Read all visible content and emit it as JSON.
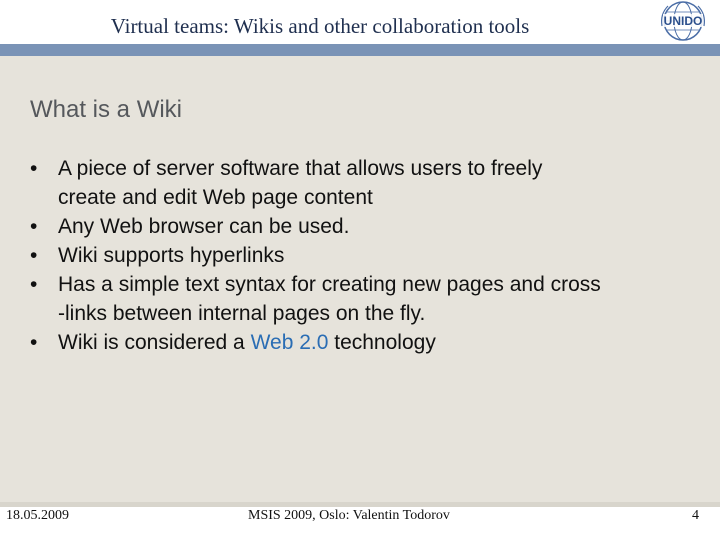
{
  "header": {
    "title": "Virtual teams: Wikis and other collaboration tools",
    "logo_text": "UNIDO"
  },
  "slide": {
    "title": "What is a Wiki",
    "bullets": [
      {
        "text_before": "A piece of server software that allows users to freely",
        "text_cont": "create and edit Web page content"
      },
      {
        "text_before": "Any Web browser can be used."
      },
      {
        "text_before": "Wiki supports hyperlinks"
      },
      {
        "text_before": "Has a simple text syntax for creating new pages and cross",
        "text_cont": "-links between internal pages on the fly."
      },
      {
        "text_before": "Wiki is considered a ",
        "link": "Web 2.0",
        "text_after": " technology"
      }
    ],
    "bullet_glyph": "•"
  },
  "footer": {
    "date": "18.05.2009",
    "center": "MSIS 2009, Oslo: Valentin Todorov",
    "page": "4"
  },
  "colors": {
    "header_rule": "#7a93b6",
    "content_bg": "#e6e3db",
    "link": "#2a6db4",
    "title_text": "#55585c"
  }
}
